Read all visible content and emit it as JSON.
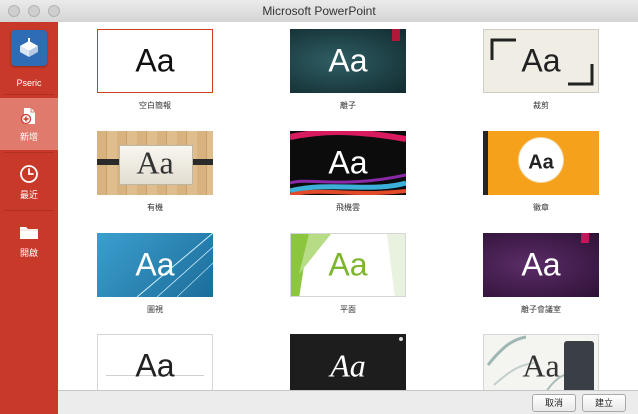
{
  "window": {
    "title": "Microsoft PowerPoint"
  },
  "sidebar": {
    "user": {
      "name": "Pseric"
    },
    "items": [
      {
        "label": "新增",
        "icon": "new-document-icon",
        "active": true
      },
      {
        "label": "最近",
        "icon": "clock-icon",
        "active": false
      },
      {
        "label": "開啟",
        "icon": "folder-icon",
        "active": false
      }
    ]
  },
  "templates": [
    {
      "caption": "空白簡報",
      "preview": "Aa"
    },
    {
      "caption": "離子",
      "preview": "Aa"
    },
    {
      "caption": "裁剪",
      "preview": "Aa"
    },
    {
      "caption": "有機",
      "preview": "Aa"
    },
    {
      "caption": "飛機雲",
      "preview": "Aa"
    },
    {
      "caption": "徽章",
      "preview": "Aa"
    },
    {
      "caption": "圖視",
      "preview": "Aa"
    },
    {
      "caption": "平面",
      "preview": "Aa"
    },
    {
      "caption": "離子會議室",
      "preview": "Aa"
    },
    {
      "caption": "",
      "preview": "Aa"
    },
    {
      "caption": "",
      "preview": "Aa"
    },
    {
      "caption": "",
      "preview": "Aa"
    }
  ],
  "footer": {
    "cancel_label": "取消",
    "create_label": "建立"
  },
  "colors": {
    "sidebar": "#c8392a",
    "sidebar_active": "#e07a6c",
    "selection_border": "#d0401f"
  }
}
